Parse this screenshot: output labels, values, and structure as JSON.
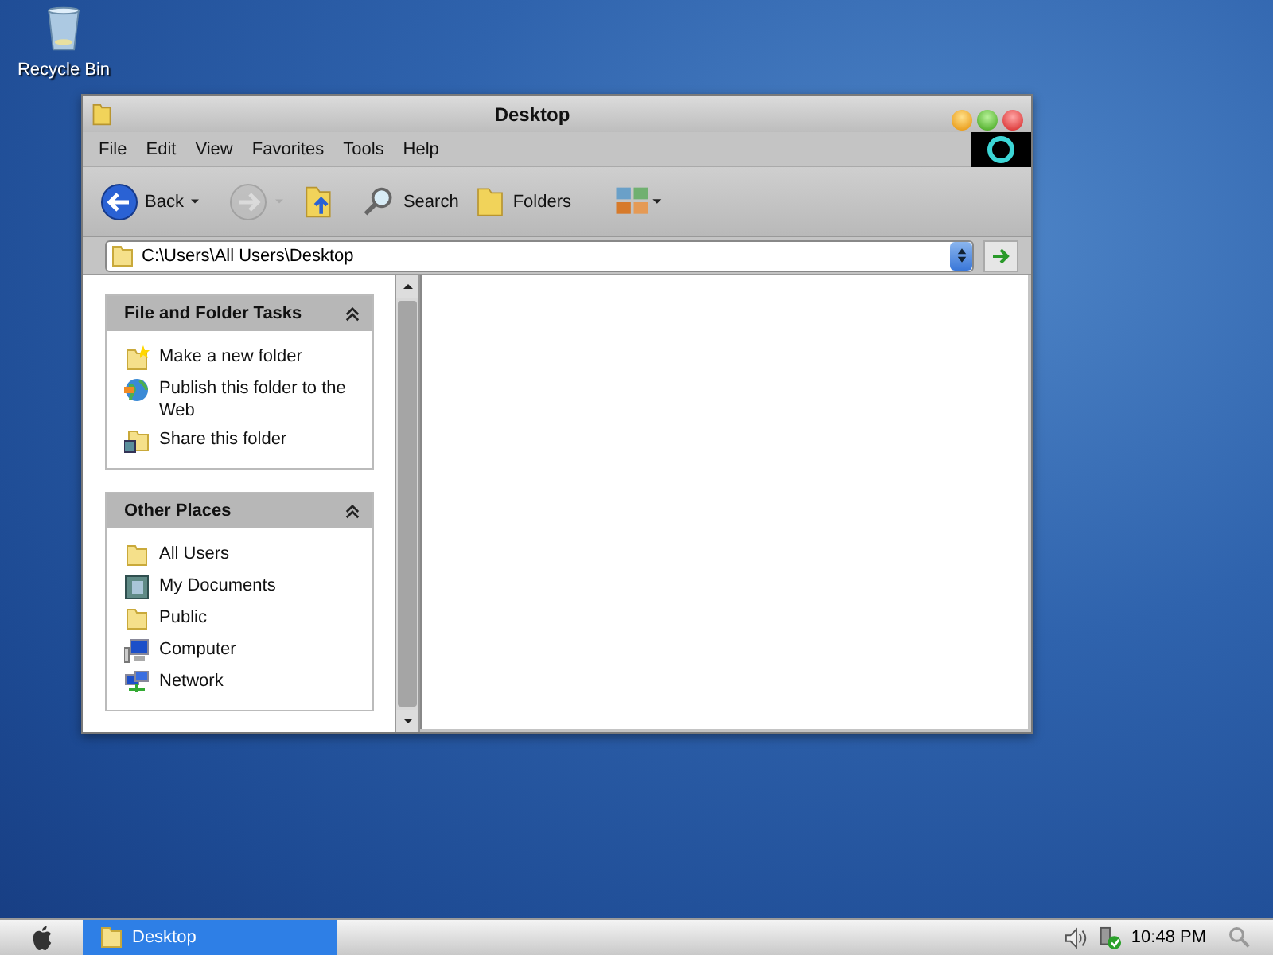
{
  "desktop_icons": [
    {
      "label": "Recycle Bin"
    }
  ],
  "window": {
    "title": "Desktop",
    "menu": [
      "File",
      "Edit",
      "View",
      "Favorites",
      "Tools",
      "Help"
    ],
    "toolbar": [
      {
        "kind": "back",
        "label": "Back",
        "disabled": false
      },
      {
        "kind": "forward",
        "disabled": true
      },
      {
        "kind": "up",
        "disabled": false
      },
      {
        "kind": "search",
        "label": "Search",
        "disabled": false
      },
      {
        "kind": "folders",
        "label": "Folders",
        "disabled": false
      },
      {
        "kind": "views",
        "disabled": false
      }
    ],
    "address": "C:\\Users\\All Users\\Desktop",
    "panels": [
      {
        "title": "File and Folder Tasks",
        "expanded": true,
        "items": [
          {
            "kind": "new-folder",
            "label": "Make a new folder"
          },
          {
            "kind": "globe",
            "label": "Publish this folder to the Web"
          },
          {
            "kind": "share-folder",
            "label": "Share this folder"
          }
        ]
      },
      {
        "title": "Other Places",
        "expanded": true,
        "items": [
          {
            "kind": "folder",
            "label": "All Users"
          },
          {
            "kind": "documents",
            "label": "My Documents"
          },
          {
            "kind": "folder",
            "label": "Public"
          },
          {
            "kind": "computer",
            "label": "Computer"
          },
          {
            "kind": "network",
            "label": "Network"
          }
        ]
      }
    ]
  },
  "taskbar": {
    "tasks": [
      {
        "label": "Desktop",
        "selected": true
      }
    ],
    "clock": "10:48 PM"
  }
}
